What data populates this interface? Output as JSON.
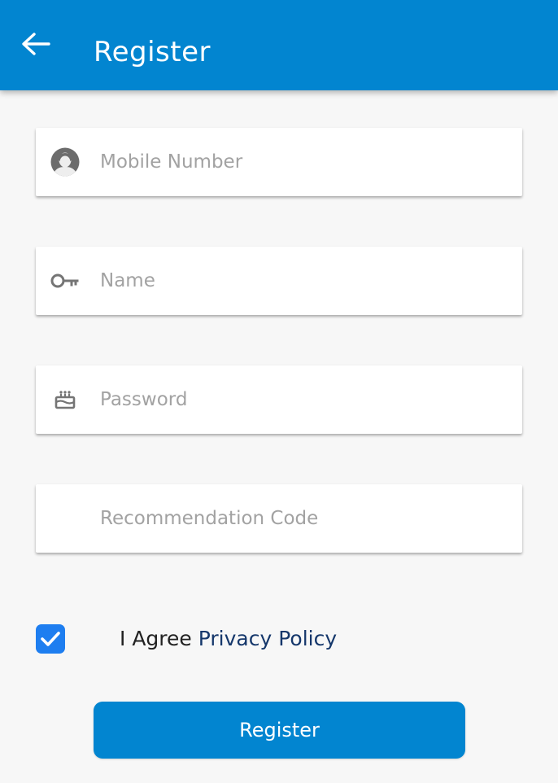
{
  "header": {
    "title": "Register",
    "back_icon": "arrow-left-icon",
    "background_color": "#0285d0"
  },
  "form": {
    "mobile": {
      "placeholder": "Mobile Number",
      "value": "",
      "icon": "person-avatar-icon"
    },
    "name": {
      "placeholder": "Name",
      "value": "",
      "icon": "key-icon"
    },
    "password": {
      "placeholder": "Password",
      "value": "",
      "icon": "cake-icon"
    },
    "recommendation": {
      "placeholder": "Recommendation Code",
      "value": ""
    }
  },
  "agreement": {
    "checked": true,
    "text": "I Agree",
    "link_label": "Privacy Policy",
    "checkbox_color": "#1e7ef0",
    "link_color": "#15376b"
  },
  "actions": {
    "register_label": "Register",
    "button_color": "#0285d0"
  }
}
